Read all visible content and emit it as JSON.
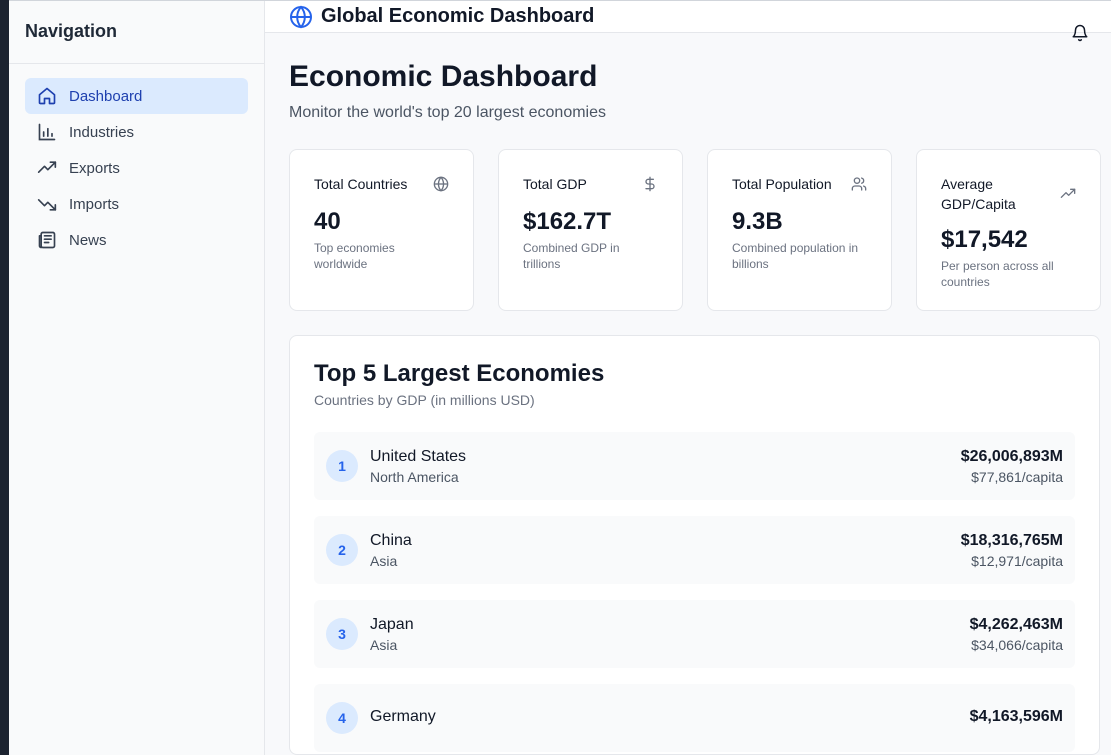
{
  "sidebar": {
    "title": "Navigation",
    "items": [
      {
        "label": "Dashboard",
        "icon": "home-icon",
        "active": true
      },
      {
        "label": "Industries",
        "icon": "bar-chart-icon"
      },
      {
        "label": "Exports",
        "icon": "trending-up-icon"
      },
      {
        "label": "Imports",
        "icon": "trending-down-icon"
      },
      {
        "label": "News",
        "icon": "newspaper-icon"
      }
    ]
  },
  "header": {
    "title": "Global Economic Dashboard",
    "icon": "globe-icon",
    "notification_icon": "bell-icon"
  },
  "page": {
    "title": "Economic Dashboard",
    "subtitle": "Monitor the world's top 20 largest economies"
  },
  "stats": [
    {
      "label": "Total Countries",
      "icon": "globe-icon",
      "value": "40",
      "description": "Top economies worldwide"
    },
    {
      "label": "Total GDP",
      "icon": "dollar-icon",
      "value": "$162.7T",
      "description": "Combined GDP in trillions"
    },
    {
      "label": "Total Population",
      "icon": "users-icon",
      "value": "9.3B",
      "description": "Combined population in billions"
    },
    {
      "label": "Average GDP/Capita",
      "icon": "trending-up-icon",
      "value": "$17,542",
      "description": "Per person across all countries"
    }
  ],
  "top_economies": {
    "title": "Top 5 Largest Economies",
    "subtitle": "Countries by GDP (in millions USD)",
    "rows": [
      {
        "rank": "1",
        "country": "United States",
        "region": "North America",
        "gdp": "$26,006,893M",
        "per_capita": "$77,861/capita"
      },
      {
        "rank": "2",
        "country": "China",
        "region": "Asia",
        "gdp": "$18,316,765M",
        "per_capita": "$12,971/capita"
      },
      {
        "rank": "3",
        "country": "Japan",
        "region": "Asia",
        "gdp": "$4,262,463M",
        "per_capita": "$34,066/capita"
      },
      {
        "rank": "4",
        "country": "Germany",
        "region": "",
        "gdp": "$4,163,596M",
        "per_capita": ""
      }
    ]
  },
  "colors": {
    "accent": "#2563eb",
    "active_bg": "#dbeafe",
    "active_text": "#1e40af"
  }
}
